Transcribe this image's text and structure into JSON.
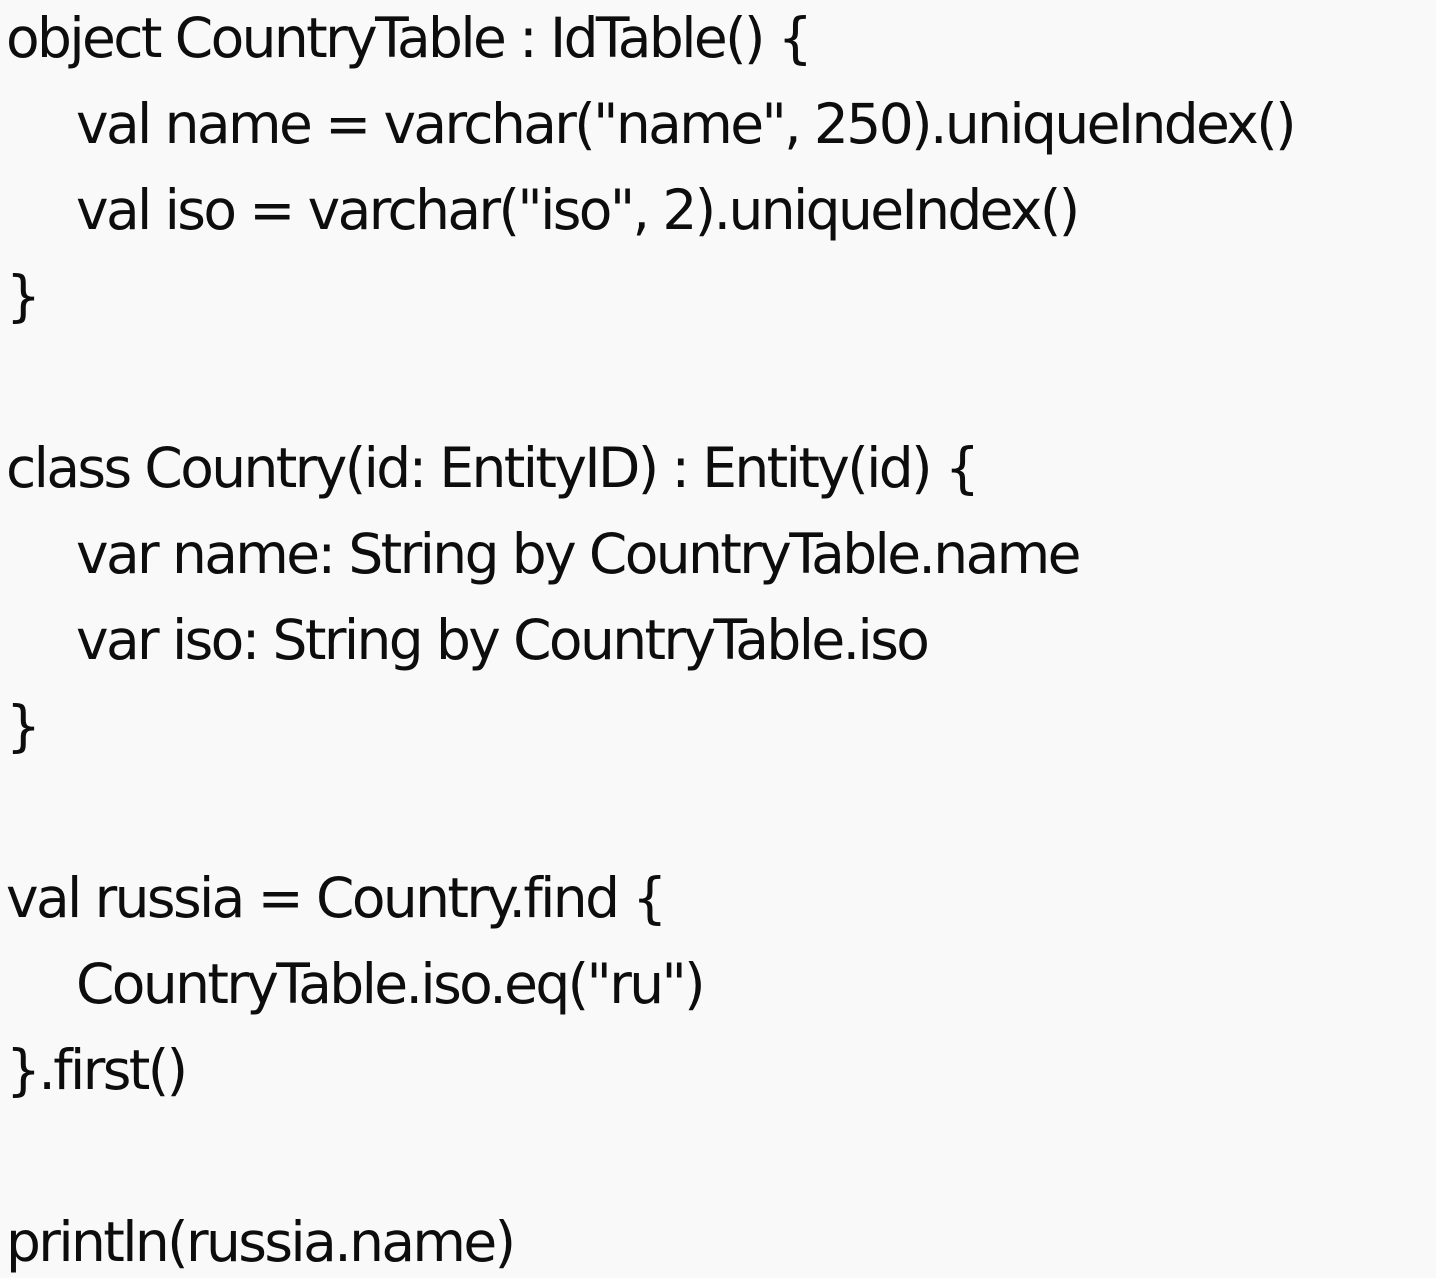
{
  "code": {
    "lines": [
      "object CountryTable : IdTable() {",
      "val name = varchar(\"name\", 250).uniqueIndex()",
      "val iso = varchar(\"iso\", 2).uniqueIndex()",
      "}",
      "",
      "class Country(id: EntityID) : Entity(id) {",
      "var name: String by CountryTable.name",
      "var iso: String by CountryTable.iso",
      "}",
      "",
      "val russia = Country.find {",
      "CountryTable.iso.eq(\"ru\")",
      "}.first()",
      "",
      "println(russia.name)"
    ]
  },
  "colors": {
    "background": "#f9f9f9",
    "text": "#0d0d0d"
  }
}
